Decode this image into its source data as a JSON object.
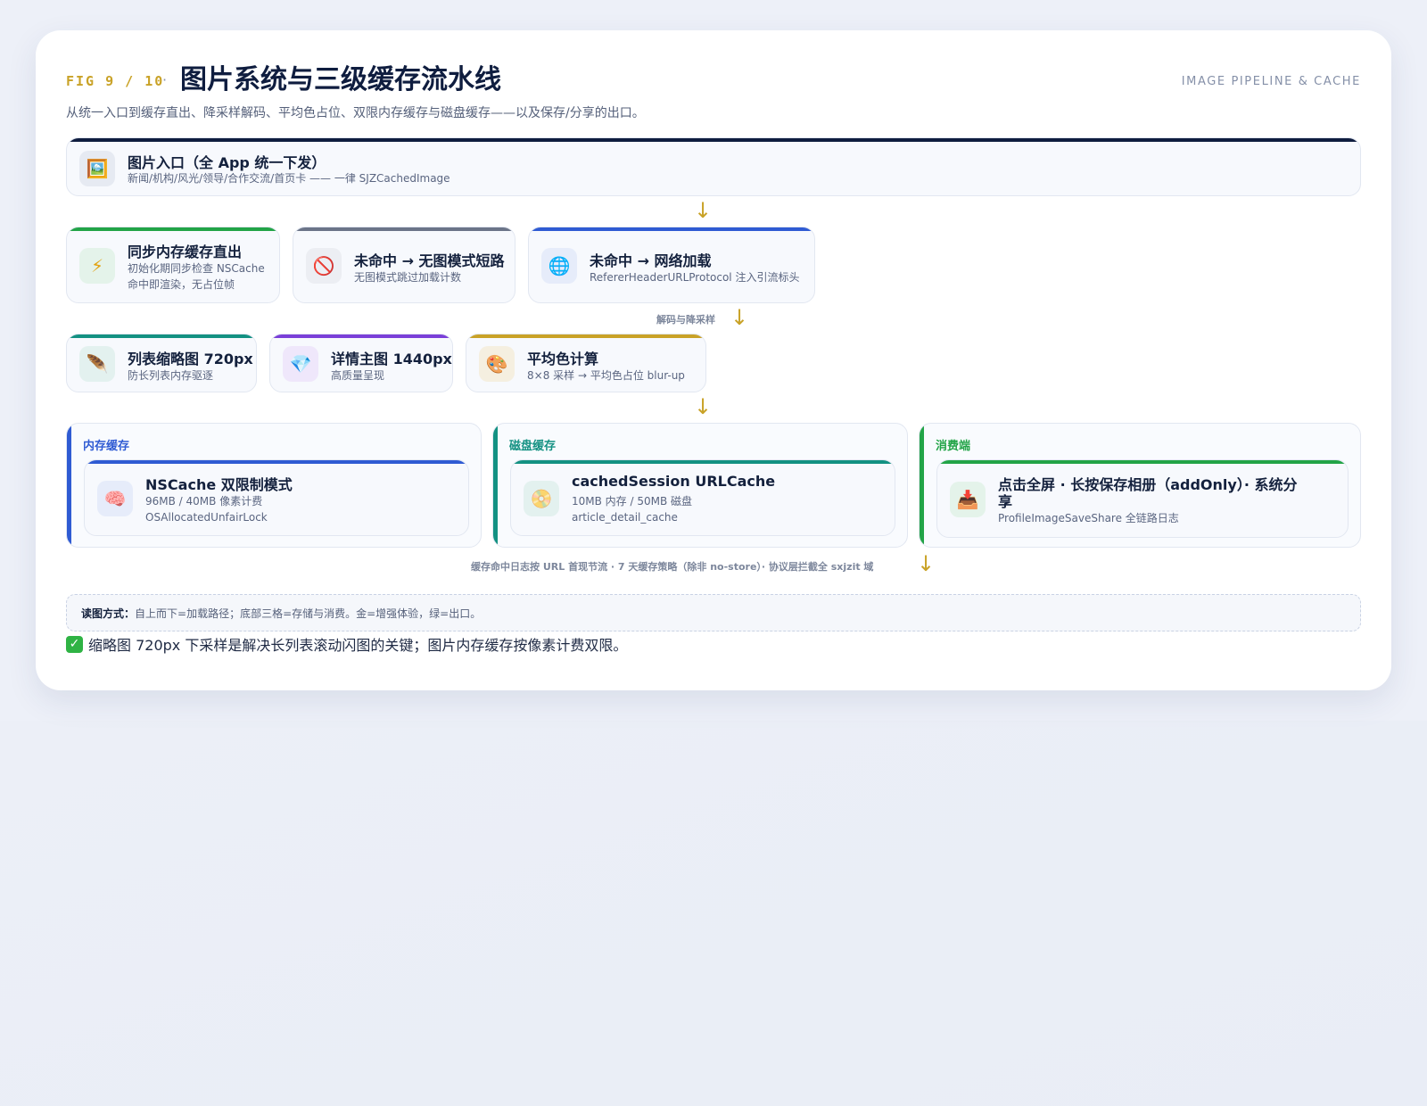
{
  "header": {
    "fig": "FIG 9 / 10",
    "separator": "·",
    "title": "图片系统与三级缓存流水线",
    "tag": "IMAGE PIPELINE & CACHE",
    "subtitle": "从统一入口到缓存直出、降采样解码、平均色占位、双限内存缓存与磁盘缓存——以及保存/分享的出口。"
  },
  "colors": {
    "navy": "#0f1d3f",
    "gold": "#c9a227",
    "green": "#22a447",
    "slate": "#6b7488",
    "blue": "#2f5bd3",
    "teal": "#139182",
    "purple": "#7a3fd8"
  },
  "nodes": {
    "entry": {
      "icon": "framed-picture-icon",
      "glyph": "🖼️",
      "title": "图片入口（全 App 统一下发）",
      "sub": "新闻/机构/风光/领导/合作交流/首页卡 —— 一律 SJZCachedImage"
    },
    "sync": {
      "icon": "lightning-icon",
      "glyph": "⚡",
      "title": "同步内存缓存直出",
      "sub1": "初始化期同步检查 NSCache",
      "sub2": "命中即渲染，无占位帧"
    },
    "noimage": {
      "icon": "no-entry-icon",
      "glyph": "🚫",
      "title": "未命中 → 无图模式短路",
      "sub": "无图模式跳过加载计数"
    },
    "network": {
      "icon": "globe-icon",
      "glyph": "🌐",
      "title": "未命中 → 网络加载",
      "sub": "RefererHeaderURLProtocol 注入引流标头"
    },
    "thumb": {
      "icon": "feather-icon",
      "glyph": "🪶",
      "title": "列表缩略图 720px",
      "sub": "防长列表内存驱逐"
    },
    "detail": {
      "icon": "gem-icon",
      "glyph": "💎",
      "title": "详情主图 1440px",
      "sub": "高质量呈现"
    },
    "avg": {
      "icon": "palette-icon",
      "glyph": "🎨",
      "title": "平均色计算",
      "sub": "8×8 采样 → 平均色占位 blur-up"
    }
  },
  "edges": {
    "decode": "解码与降采样",
    "footer": "缓存命中日志按 URL 首现节流 · 7 天缓存策略（除非 no-store）· 协议层拦截全 sxjzit 域"
  },
  "groups": {
    "memory": {
      "label": "内存缓存",
      "icon": "brain-icon",
      "glyph": "🧠",
      "title": "NSCache 双限制模式",
      "sub1": "96MB / 40MB 像素计费",
      "sub2": "OSAllocatedUnfairLock"
    },
    "disk": {
      "label": "磁盘缓存",
      "icon": "disc-icon",
      "glyph": "📀",
      "title": "cachedSession URLCache",
      "sub1": "10MB 内存 / 50MB 磁盘",
      "sub2": "article_detail_cache"
    },
    "consumer": {
      "label": "消费端",
      "icon": "inbox-tray-icon",
      "glyph": "📥",
      "title1": "点击全屏 · 长按保存相册（addOnly）· 系统分",
      "title2": "享",
      "sub": "ProfileImageSaveShare 全链路日志"
    }
  },
  "legend": {
    "label": "读图方式：",
    "text": "自上而下=加载路径；底部三格=存储与消费。金=增强体验，绿=出口。"
  },
  "tip": {
    "icon": "check-mark-icon",
    "glyph": "✓",
    "text": "缩略图 720px 下采样是解决长列表滚动闪图的关键；图片内存缓存按像素计费双限。"
  }
}
